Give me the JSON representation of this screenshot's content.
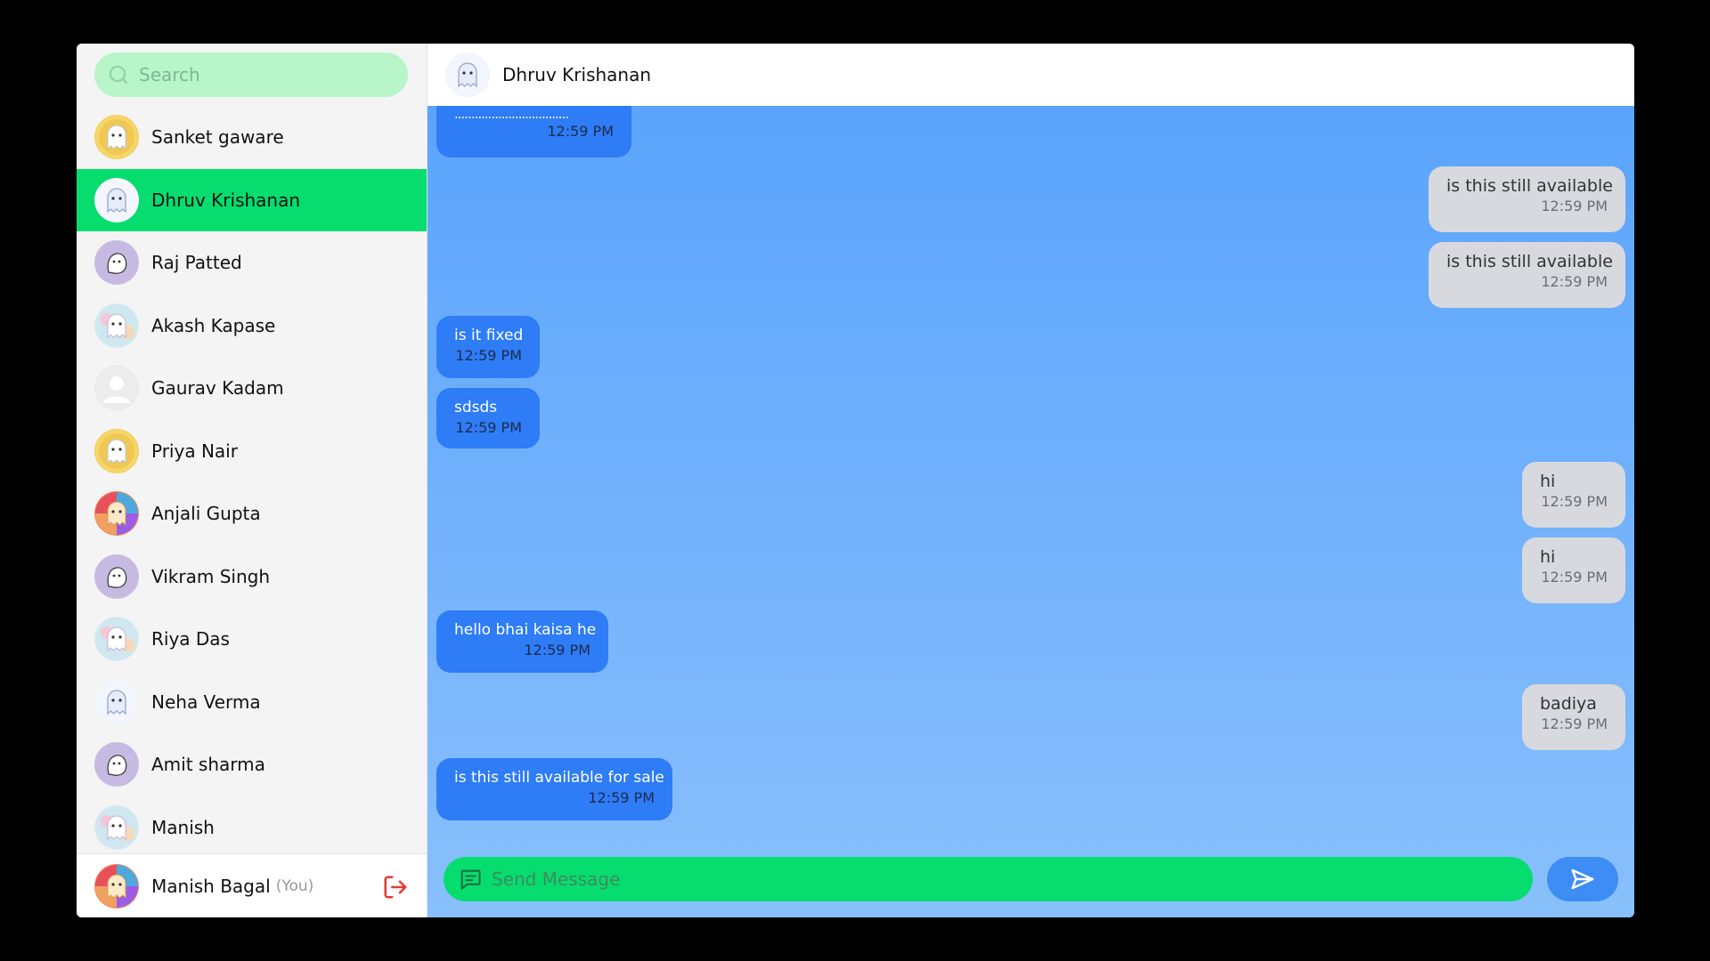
{
  "search": {
    "placeholder": "Search"
  },
  "contacts": [
    {
      "name": "Sanket gaware",
      "avatar": "ghost-yellow-icon"
    },
    {
      "name": "Dhruv Krishanan",
      "avatar": "ghost-white-icon",
      "active": true
    },
    {
      "name": "Raj Patted",
      "avatar": "ghost-purple-icon"
    },
    {
      "name": "Akash Kapase",
      "avatar": "ghost-pastel-icon"
    },
    {
      "name": "Gaurav Kadam",
      "avatar": "default-user-icon"
    },
    {
      "name": "Priya Nair",
      "avatar": "ghost-yellow-icon"
    },
    {
      "name": "Anjali Gupta",
      "avatar": "ghost-rainbow-icon"
    },
    {
      "name": "Vikram Singh",
      "avatar": "ghost-purple-icon"
    },
    {
      "name": "Riya Das",
      "avatar": "ghost-pastel-icon"
    },
    {
      "name": "Neha Verma",
      "avatar": "ghost-white-icon"
    },
    {
      "name": "Amit sharma",
      "avatar": "ghost-purple-icon"
    },
    {
      "name": "Manish",
      "avatar": "ghost-pastel-icon"
    }
  ],
  "me": {
    "name": "Manish Bagal",
    "you_label": "(You)"
  },
  "chat": {
    "header_name": "Dhruv Krishanan",
    "messages": [
      {
        "dir": "in",
        "text": "..................................",
        "time": "12:59 PM"
      },
      {
        "dir": "out",
        "text": "is this still available",
        "time": "12:59 PM"
      },
      {
        "dir": "out",
        "text": "is this still available",
        "time": "12:59 PM"
      },
      {
        "dir": "in",
        "text": "is it fixed",
        "time": "12:59 PM"
      },
      {
        "dir": "in",
        "text": "sdsds",
        "time": "12:59 PM"
      },
      {
        "dir": "out",
        "text": "hi",
        "time": "12:59 PM"
      },
      {
        "dir": "out",
        "text": "hi",
        "time": "12:59 PM"
      },
      {
        "dir": "in",
        "text": "hello bhai kaisa he",
        "time": "12:59 PM"
      },
      {
        "dir": "out",
        "text": "badiya",
        "time": "12:59 PM"
      },
      {
        "dir": "in",
        "text": "is this still available for sale",
        "time": "12:59 PM"
      }
    ],
    "composer_placeholder": "Send Message"
  },
  "colors": {
    "active_contact": "#06dd6e",
    "search_bg": "#b8f5c9",
    "incoming_bubble": "#2e7cf6",
    "outgoing_bubble": "#d7d9de",
    "send_button": "#3d8df5",
    "logout_icon": "#e53935"
  }
}
